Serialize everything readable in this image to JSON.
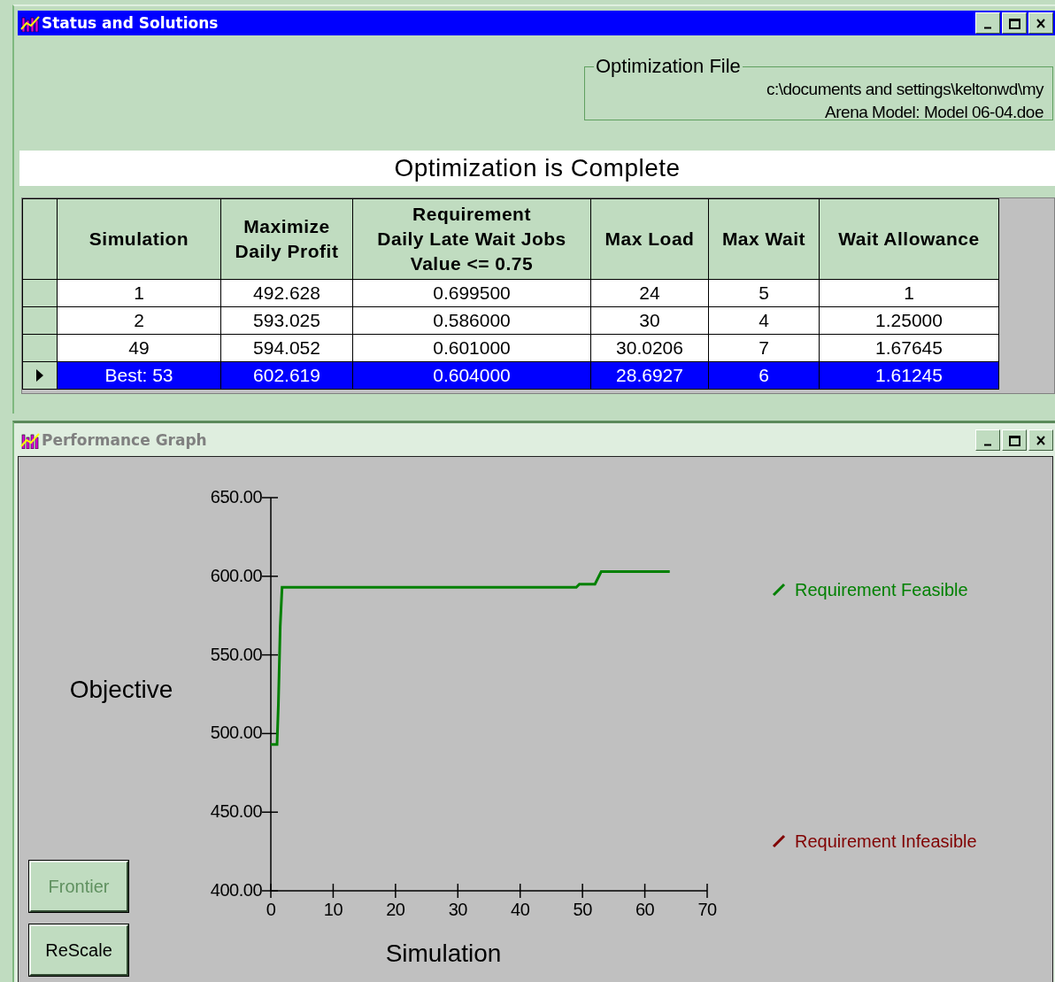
{
  "status_window": {
    "title": "Status and Solutions",
    "active": true,
    "optimization_file": {
      "legend": "Optimization File",
      "lines": [
        "c:\\documents and settings\\keltonwd\\my",
        "Arena Model: Model 06-04.doe"
      ]
    },
    "banner": "Optimization is Complete",
    "table": {
      "columns": [
        "Simulation",
        "Maximize\nDaily Profit",
        "Requirement\nDaily Late Wait Jobs\nValue <= 0.75",
        "Max Load",
        "Max Wait",
        "Wait Allowance"
      ],
      "rows": [
        {
          "selected": false,
          "cells": [
            "1",
            "492.628",
            "0.699500",
            "24",
            "5",
            "1"
          ]
        },
        {
          "selected": false,
          "cells": [
            "2",
            "593.025",
            "0.586000",
            "30",
            "4",
            "1.25000"
          ]
        },
        {
          "selected": false,
          "cells": [
            "49",
            "594.052",
            "0.601000",
            "30.0206",
            "7",
            "1.67645"
          ]
        },
        {
          "selected": true,
          "cells": [
            "Best: 53",
            "602.619",
            "0.604000",
            "28.6927",
            "6",
            "1.61245"
          ]
        }
      ]
    }
  },
  "graph_window": {
    "title": "Performance Graph",
    "active": false,
    "buttons": [
      {
        "label": "Frontier",
        "disabled": true
      },
      {
        "label": "ReScale",
        "disabled": false
      }
    ],
    "chart_data": {
      "type": "line",
      "xlabel": "Simulation",
      "ylabel": "Objective",
      "x": [
        0,
        1,
        1.2,
        1.5,
        1.8,
        2,
        49,
        49.5,
        52,
        53,
        64
      ],
      "series": [
        {
          "name": "Requirement Feasible",
          "color": "#008000",
          "values": [
            493,
            493,
            518,
            568,
            593,
            593,
            593,
            595,
            595,
            603,
            603
          ]
        },
        {
          "name": "Requirement Infeasible",
          "color": "#800000",
          "values": [
            null,
            null,
            null,
            null,
            null,
            null,
            null,
            null,
            null,
            null,
            null
          ]
        }
      ],
      "xlim": [
        0,
        70
      ],
      "ylim": [
        400,
        650
      ],
      "xticks": [
        0,
        10,
        20,
        30,
        40,
        50,
        60,
        70
      ],
      "yticks": [
        {
          "value": 400,
          "label": "400.00"
        },
        {
          "value": 450,
          "label": "450.00"
        },
        {
          "value": 500,
          "label": "500.00"
        },
        {
          "value": 550,
          "label": "550.00"
        },
        {
          "value": 600,
          "label": "600.00"
        },
        {
          "value": 650,
          "label": "650.00"
        }
      ]
    }
  }
}
